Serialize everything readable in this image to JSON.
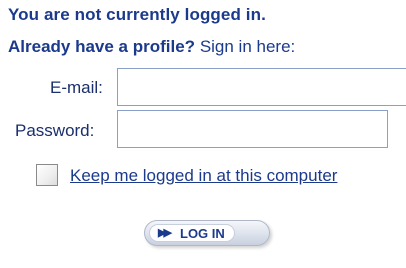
{
  "login": {
    "status_message": "You are not currently logged in.",
    "profile_prompt": "Already have a profile?",
    "sign_in_hint": "Sign in here:",
    "email_label": "E-mail:",
    "email_value": "",
    "password_label": "Password:",
    "password_value": "",
    "keep_logged_in_label": "Keep me logged in at this computer",
    "keep_logged_in_checked": false,
    "button_label": "LOG IN",
    "button_icon": "double-arrow-right-icon"
  },
  "colors": {
    "text_primary": "#1c3a8c",
    "input_border": "#8aa0c8",
    "background": "#ffffff"
  }
}
